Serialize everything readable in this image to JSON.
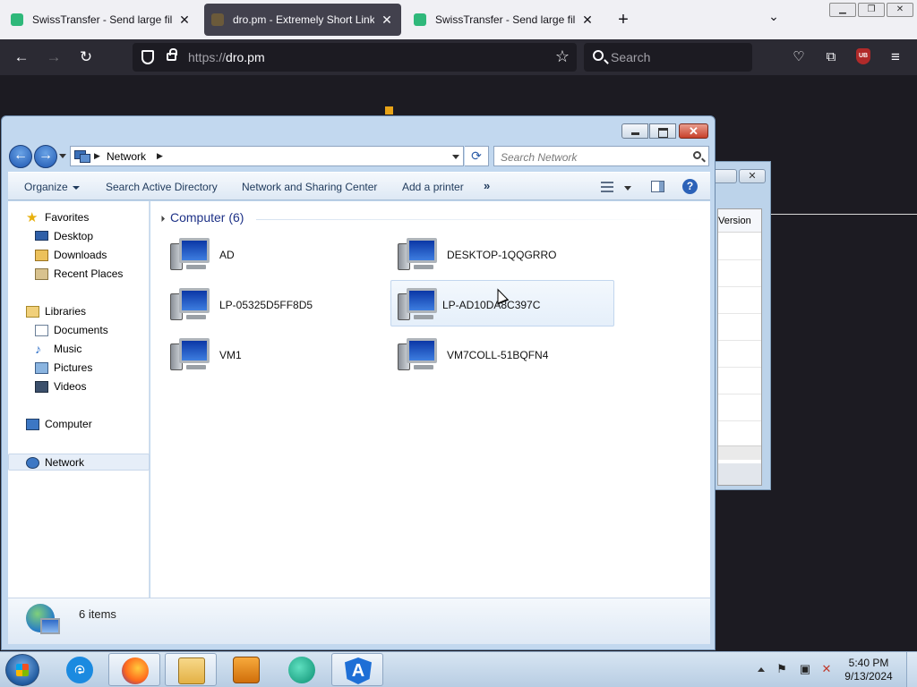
{
  "browser": {
    "tabs": [
      {
        "title": "SwissTransfer - Send large files",
        "active": false
      },
      {
        "title": "dro.pm - Extremely Short Links",
        "active": true
      },
      {
        "title": "SwissTransfer - Send large files",
        "active": false
      }
    ],
    "url_scheme": "https://",
    "url_host": "dro.pm",
    "search_placeholder": "Search",
    "ublock_label": "UB"
  },
  "background_window": {
    "column_header": "Version"
  },
  "explorer": {
    "breadcrumb": "Network",
    "search_placeholder": "Search Network",
    "commands": {
      "organize": "Organize",
      "search_ad": "Search Active Directory",
      "network_sharing": "Network and Sharing Center",
      "add_printer": "Add a printer",
      "more": "»",
      "help": "?"
    },
    "nav": {
      "favorites": "Favorites",
      "desktop": "Desktop",
      "downloads": "Downloads",
      "recent_places": "Recent Places",
      "libraries": "Libraries",
      "documents": "Documents",
      "music": "Music",
      "pictures": "Pictures",
      "videos": "Videos",
      "computer": "Computer",
      "network": "Network"
    },
    "group_header": "Computer (6)",
    "computers": [
      "AD",
      "DESKTOP-1QQGRRO",
      "LP-05325D5FF8D5",
      "LP-AD10DA8C397C",
      "VM1",
      "VM7COLL-51BQFN4"
    ],
    "hovered_computer": "LP-AD10DA8C397C",
    "item_count": "6 items"
  },
  "taskbar": {
    "time": "5:40 PM",
    "date": "9/13/2024",
    "pinned": [
      "internet-explorer",
      "firefox",
      "windows-explorer",
      "media-player",
      "teal-app",
      "angular-app"
    ],
    "active": [
      "firefox",
      "windows-explorer",
      "angular-app"
    ]
  },
  "colors": {
    "firefox_tabbar": "#f0f0f4",
    "firefox_toolbar": "#2b2a33",
    "explorer_frame": "#c2d8ef",
    "group_header_blue": "#1e3287",
    "close_button_red": "#c7402a"
  }
}
